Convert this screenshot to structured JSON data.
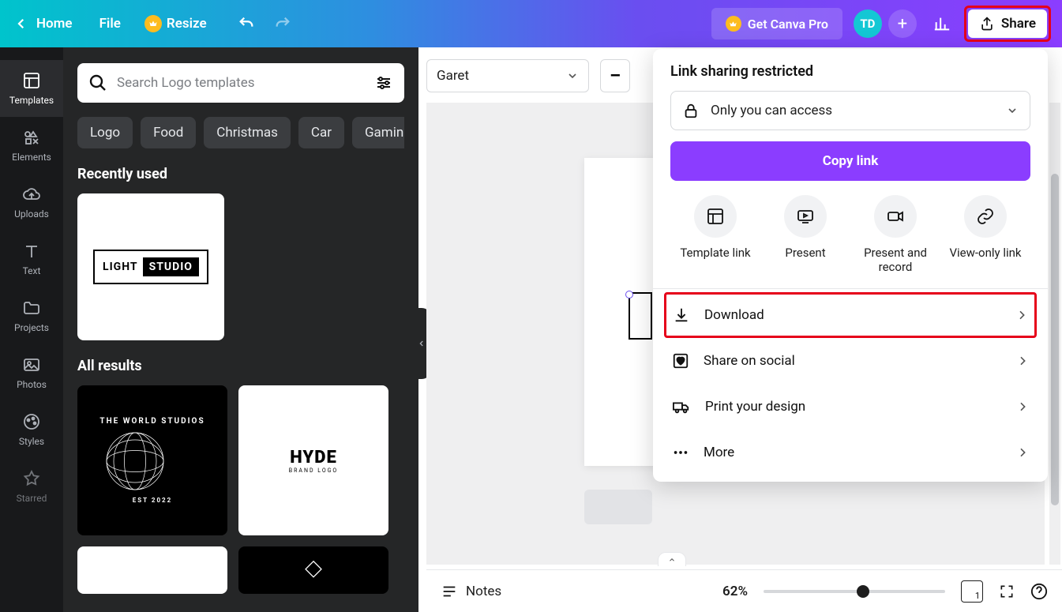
{
  "topbar": {
    "home": "Home",
    "file": "File",
    "resize": "Resize",
    "pro": "Get Canva Pro",
    "avatar": "TD",
    "share": "Share"
  },
  "rail": {
    "templates": "Templates",
    "elements": "Elements",
    "uploads": "Uploads",
    "text": "Text",
    "projects": "Projects",
    "photos": "Photos",
    "styles": "Styles",
    "starred": "Starred"
  },
  "panel": {
    "search_placeholder": "Search Logo templates",
    "chips": [
      "Logo",
      "Food",
      "Christmas",
      "Car",
      "Gaming"
    ],
    "recently_used": "Recently used",
    "all_results": "All results",
    "template1_a": "LIGHT",
    "template1_b": "STUDIO",
    "template2_top": "THE WORLD STUDIOS",
    "template2_sub": "EST 2022",
    "template3_a": "HYDE",
    "template3_b": "BRAND LOGO"
  },
  "editor": {
    "font": "Garet",
    "minus": "–"
  },
  "popover": {
    "title": "Link sharing restricted",
    "access": "Only you can access",
    "copy": "Copy link",
    "options": {
      "template": "Template link",
      "present": "Present",
      "present_record": "Present and record",
      "view_only": "View-only link"
    },
    "download": "Download",
    "share_social": "Share on social",
    "print": "Print your design",
    "more": "More"
  },
  "bottombar": {
    "notes": "Notes",
    "zoom": "62%",
    "page": "1"
  }
}
